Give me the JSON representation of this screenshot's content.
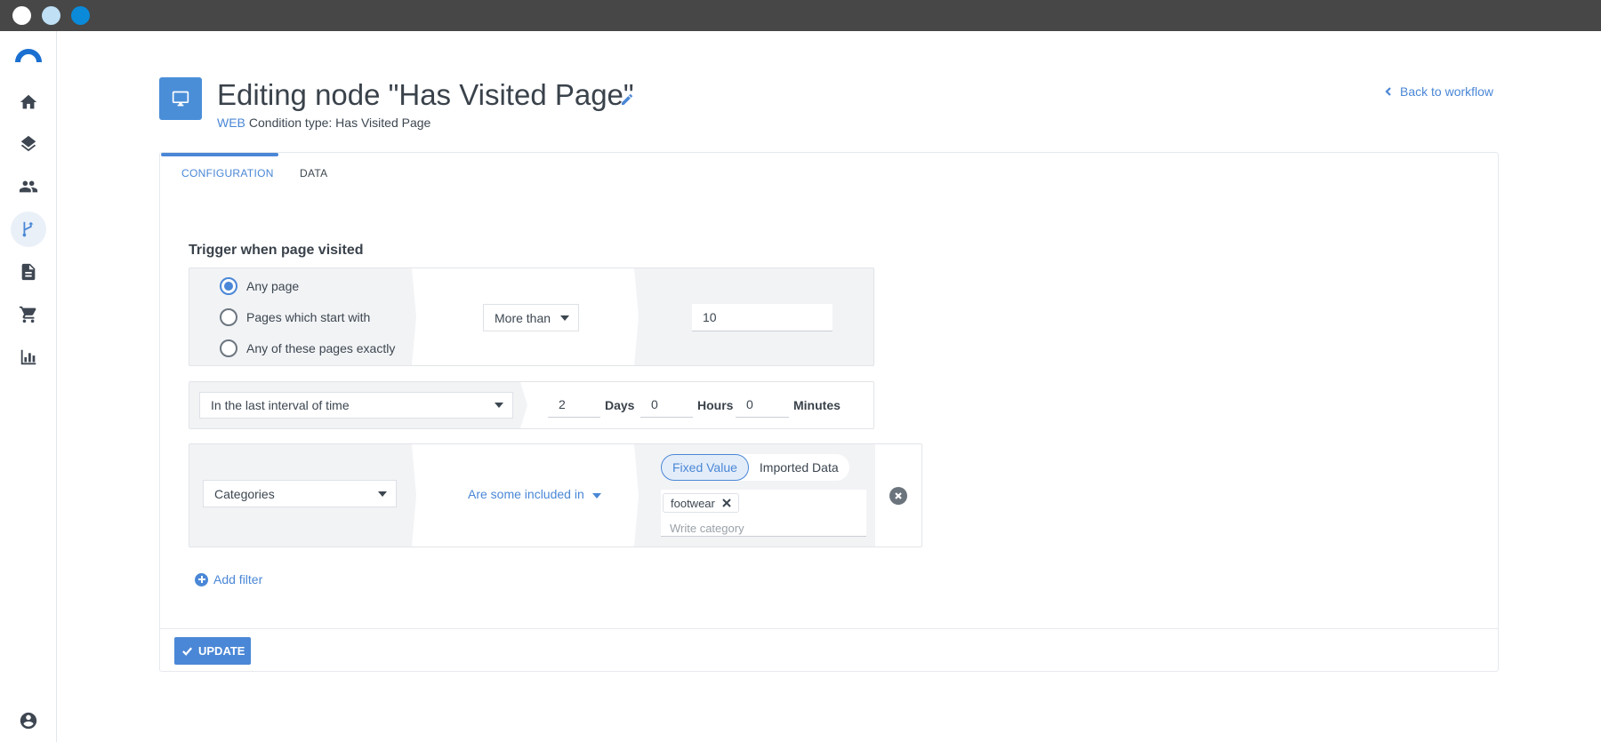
{
  "header": {
    "title": "Editing node \"Has Visited Page\"",
    "channel_tag": "WEB",
    "condition_type": "Condition type: Has Visited Page",
    "back_link": "Back to workflow"
  },
  "tabs": [
    {
      "label": "CONFIGURATION",
      "active": true
    },
    {
      "label": "DATA",
      "active": false
    }
  ],
  "trigger": {
    "section_title": "Trigger when page visited",
    "page_options": [
      {
        "label": "Any page",
        "checked": true
      },
      {
        "label": "Pages which start with",
        "checked": false
      },
      {
        "label": "Any of these pages exactly",
        "checked": false
      }
    ],
    "comparison": "More than",
    "count_value": "10"
  },
  "interval": {
    "mode": "In the last interval of time",
    "days_value": "2",
    "days_label": "Days",
    "hours_value": "0",
    "hours_label": "Hours",
    "minutes_value": "0",
    "minutes_label": "Minutes"
  },
  "filter": {
    "field": "Categories",
    "operator": "Are some included in",
    "value_mode_options": [
      "Fixed Value",
      "Imported Data"
    ],
    "selected_mode": "Fixed Value",
    "tags": [
      "footwear"
    ],
    "placeholder": "Write category"
  },
  "actions": {
    "add_filter": "Add filter",
    "update": "UPDATE"
  },
  "colors": {
    "accent": "#4a87d6",
    "titlebar": "#474747",
    "block_bg": "#f2f3f5"
  }
}
